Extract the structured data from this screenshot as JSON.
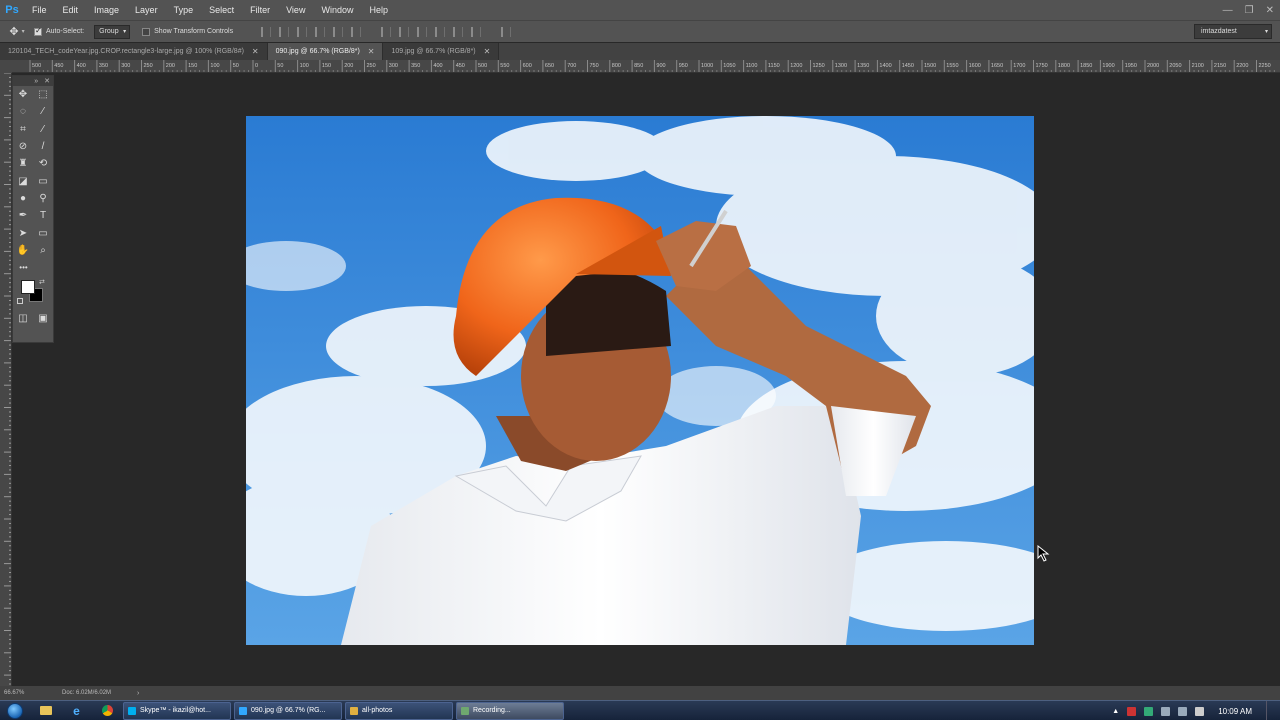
{
  "app": {
    "logo": "Ps"
  },
  "menubar": {
    "items": [
      "File",
      "Edit",
      "Image",
      "Layer",
      "Type",
      "Select",
      "Filter",
      "View",
      "Window",
      "Help"
    ]
  },
  "window_controls": {
    "minimize": "—",
    "restore": "❐",
    "close": "✕"
  },
  "options": {
    "auto_select_label": "Auto-Select:",
    "auto_select_checked": true,
    "group_value": "Group",
    "show_transform_label": "Show Transform Controls",
    "show_transform_checked": false,
    "workspace": "imtazdatest"
  },
  "tabs": [
    {
      "label": "120104_TECH_codeYear.jpg.CROP.rectangle3-large.jpg @ 100% (RGB/8#)",
      "active": false
    },
    {
      "label": "090.jpg @ 66.7% (RGB/8*)",
      "active": true
    },
    {
      "label": "109.jpg @ 66.7% (RGB/8*)",
      "active": false
    }
  ],
  "ruler_top": [
    "500",
    "450",
    "400",
    "350",
    "300",
    "250",
    "200",
    "150",
    "100",
    "50",
    "0",
    "50",
    "100",
    "150",
    "200",
    "250",
    "300",
    "350",
    "400",
    "450",
    "500",
    "550",
    "600",
    "650",
    "700",
    "750",
    "800",
    "850",
    "900",
    "950",
    "1000",
    "1050",
    "1100",
    "1150",
    "1200",
    "1250",
    "1300",
    "1350",
    "1400",
    "1450",
    "1500",
    "1550",
    "1600",
    "1650",
    "1700",
    "1750",
    "1800",
    "1850",
    "1900",
    "1950",
    "2000",
    "2050",
    "2100",
    "2150",
    "2200",
    "2250"
  ],
  "tools": [
    [
      "move-icon",
      "marquee-icon"
    ],
    [
      "lasso-icon",
      "magic-wand-icon"
    ],
    [
      "crop-icon",
      "eyedropper-icon"
    ],
    [
      "healing-brush-icon",
      "brush-icon"
    ],
    [
      "clone-stamp-icon",
      "history-brush-icon"
    ],
    [
      "eraser-icon",
      "gradient-icon"
    ],
    [
      "blur-icon",
      "dodge-icon"
    ],
    [
      "pen-icon",
      "type-icon"
    ],
    [
      "path-select-icon",
      "rectangle-icon"
    ],
    [
      "hand-icon",
      "zoom-icon"
    ]
  ],
  "toolbar_glyphs": {
    "move-icon": "✥",
    "marquee-icon": "⬚",
    "lasso-icon": "◌",
    "magic-wand-icon": "⁄",
    "crop-icon": "⌗",
    "eyedropper-icon": "⁄",
    "healing-brush-icon": "⊘",
    "brush-icon": "/",
    "clone-stamp-icon": "♜",
    "history-brush-icon": "⟲",
    "eraser-icon": "◪",
    "gradient-icon": "▭",
    "blur-icon": "●",
    "dodge-icon": "⚲",
    "pen-icon": "✒",
    "type-icon": "T",
    "path-select-icon": "➤",
    "rectangle-icon": "▭",
    "hand-icon": "✋",
    "zoom-icon": "⌕"
  },
  "extra_tools": "•••",
  "colors": {
    "foreground": "#ffffff",
    "background": "#000000",
    "accent": "#31a8ff"
  },
  "status": {
    "zoom": "66.67%",
    "doc": "Doc: 6.02M/6.02M",
    "arrow": "›"
  },
  "taskbar": {
    "buttons": [
      {
        "label": "Skype™ - ikazil@hot...",
        "icon_color": "#00aff0",
        "active": false
      },
      {
        "label": "090.jpg @ 66.7% (RG...",
        "icon_color": "#31a8ff",
        "active": false
      },
      {
        "label": "all-photos",
        "icon_color": "#e0b040",
        "active": false
      },
      {
        "label": "Recording...",
        "icon_color": "#6fa86f",
        "active": true
      }
    ],
    "clock": "10:09 AM"
  }
}
